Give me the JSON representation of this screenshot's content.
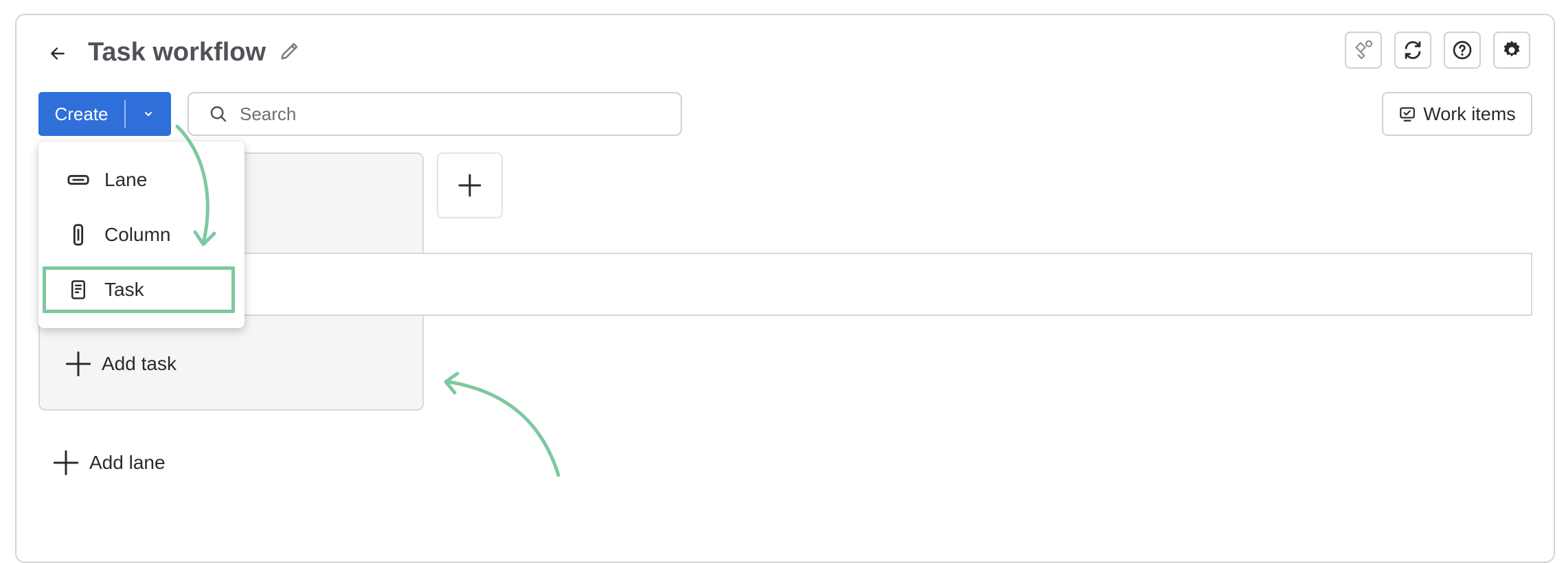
{
  "header": {
    "title": "Task workflow"
  },
  "toolbar": {
    "create_label": "Create",
    "search_placeholder": "Search",
    "work_items_label": "Work items"
  },
  "create_menu": {
    "items": [
      {
        "label": "Lane",
        "icon": "lane-icon"
      },
      {
        "label": "Column",
        "icon": "column-icon"
      },
      {
        "label": "Task",
        "icon": "task-icon",
        "highlighted": true
      }
    ]
  },
  "board": {
    "add_task_label": "Add task",
    "add_lane_label": "Add lane"
  },
  "header_actions": [
    "integration-icon",
    "sync-icon",
    "help-icon",
    "settings-icon"
  ],
  "colors": {
    "primary": "#2f6fd9",
    "annotation": "#7ec8a1",
    "column_bg": "#f5f5f5"
  }
}
